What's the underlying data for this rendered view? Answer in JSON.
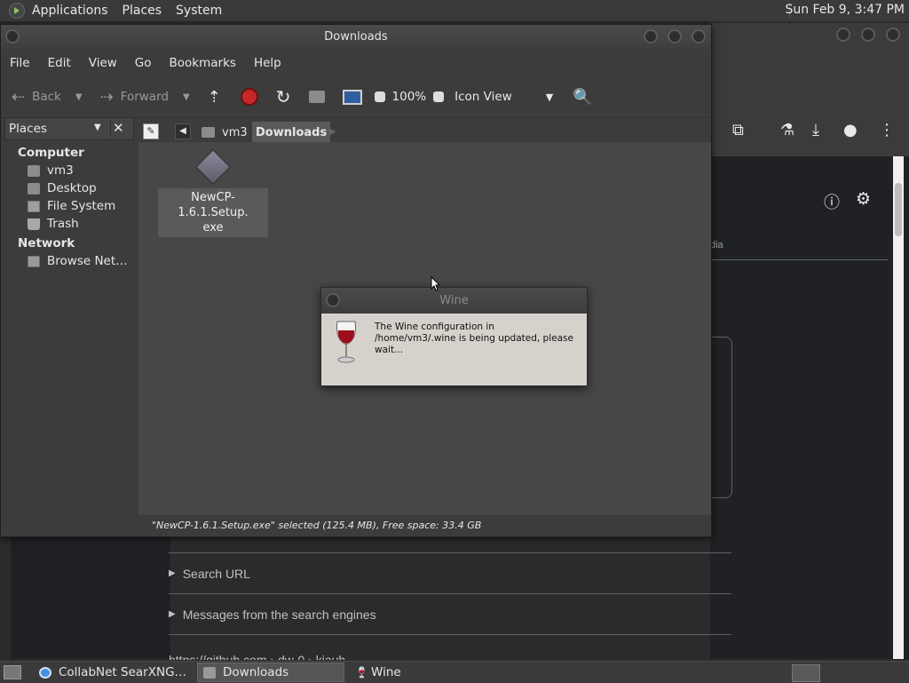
{
  "top_panel": {
    "applications": "Applications",
    "places": "Places",
    "system": "System",
    "clock": "Sun Feb  9,  3:47 PM"
  },
  "file_manager": {
    "title": "Downloads",
    "menu": [
      "File",
      "Edit",
      "View",
      "Go",
      "Bookmarks",
      "Help"
    ],
    "toolbar": {
      "back": "Back",
      "forward": "Forward",
      "zoom": "100%",
      "view_mode": "Icon View"
    },
    "location": {
      "parent": "vm3",
      "current": "Downloads"
    },
    "sidebar": {
      "header": "Places",
      "sections": [
        {
          "title": "Computer",
          "items": [
            "vm3",
            "Desktop",
            "File System",
            "Trash"
          ]
        },
        {
          "title": "Network",
          "items": [
            "Browse Net…"
          ]
        }
      ]
    },
    "file": {
      "name_line1": "NewCP-1.6.1.Setup.",
      "name_line2": "exe"
    },
    "status": "\"NewCP-1.6.1.Setup.exe\" selected (125.4 MB), Free space: 33.4 GB"
  },
  "wine_dialog": {
    "title": "Wine",
    "message": "The Wine configuration in /home/vm3/.wine is being updated, please wait..."
  },
  "browser_page": {
    "tab_fragment": "dia",
    "disclosures": [
      "Search URL",
      "Messages from the search engines"
    ],
    "url_fragment": "https://github.com › dw-0 › kiauh"
  },
  "taskbar": {
    "items": [
      {
        "label": "CollabNet SearXNG…",
        "active": false
      },
      {
        "label": "Downloads",
        "active": true
      },
      {
        "label": "Wine",
        "active": false
      }
    ]
  },
  "colors": {
    "panel": "#3a3a3a",
    "window": "#3c3c3c",
    "pane": "#474747",
    "dialog": "#d6d2cb"
  }
}
